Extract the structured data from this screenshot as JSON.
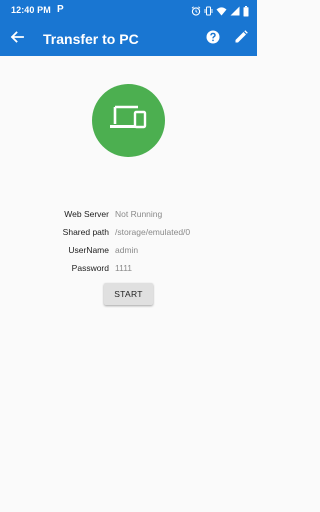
{
  "colors": {
    "primary": "#1976d2",
    "accent_green": "#4caf50",
    "background": "#fafafa",
    "button_bg": "#e0e0e0"
  },
  "status_bar": {
    "time": "12:40 PM",
    "app_indicator": "P",
    "icons": [
      "alarm-icon",
      "vibrate-icon",
      "wifi-icon",
      "signal-icon",
      "battery-icon"
    ]
  },
  "app_bar": {
    "title": "Transfer to PC",
    "back_icon": "arrow-back-icon",
    "help_icon": "help-icon",
    "edit_icon": "edit-icon"
  },
  "hero_icon": "devices-icon",
  "info": [
    {
      "label": "Web Server",
      "value": "Not Running"
    },
    {
      "label": "Shared path",
      "value": "/storage/emulated/0"
    },
    {
      "label": "UserName",
      "value": "admin"
    },
    {
      "label": "Password",
      "value": "1111"
    }
  ],
  "start_button": {
    "label": "START"
  }
}
